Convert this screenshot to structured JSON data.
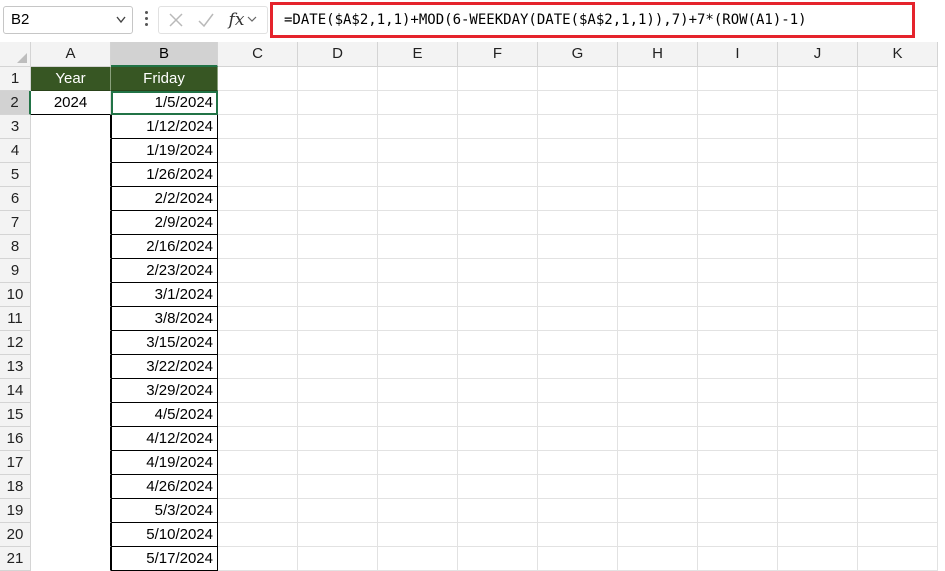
{
  "formula_bar": {
    "name_box": "B2",
    "formula": "=DATE($A$2,1,1)+MOD(6-WEEKDAY(DATE($A$2,1,1)),7)+7*(ROW(A1)-1)",
    "fx_label": "fx"
  },
  "columns": [
    "A",
    "B",
    "C",
    "D",
    "E",
    "F",
    "G",
    "H",
    "I",
    "J",
    "K"
  ],
  "rows": [
    "1",
    "2",
    "3",
    "4",
    "5",
    "6",
    "7",
    "8",
    "9",
    "10",
    "11",
    "12",
    "13",
    "14",
    "15",
    "16",
    "17",
    "18",
    "19",
    "20",
    "21"
  ],
  "sheet": {
    "header_a": "Year",
    "header_b": "Friday",
    "year": "2024",
    "fridays": [
      "1/5/2024",
      "1/12/2024",
      "1/19/2024",
      "1/26/2024",
      "2/2/2024",
      "2/9/2024",
      "2/16/2024",
      "2/23/2024",
      "3/1/2024",
      "3/8/2024",
      "3/15/2024",
      "3/22/2024",
      "3/29/2024",
      "4/5/2024",
      "4/12/2024",
      "4/19/2024",
      "4/26/2024",
      "5/3/2024",
      "5/10/2024",
      "5/17/2024"
    ]
  },
  "colors": {
    "header_fill": "#375623",
    "highlight_border": "#e5232c",
    "selection": "#217346"
  }
}
